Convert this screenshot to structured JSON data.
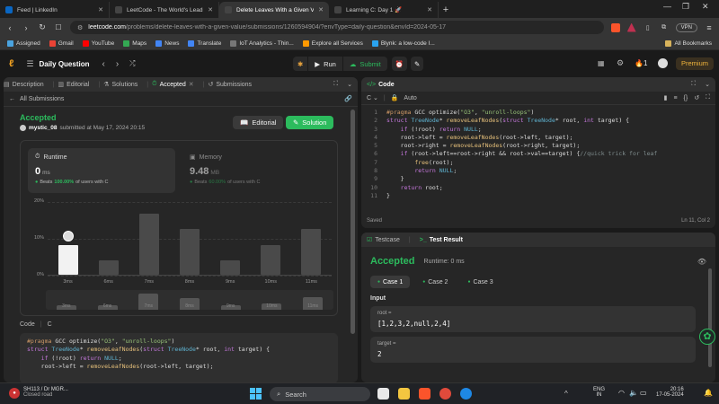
{
  "browser": {
    "tabs": [
      {
        "label": "Feed | LinkedIn",
        "color": "#0a66c2"
      },
      {
        "label": "LeetCode - The World's Leading Onl",
        "color": "#444"
      },
      {
        "label": "Delete Leaves With a Given Valu",
        "color": "#444",
        "active": true
      },
      {
        "label": "Learning C: Day 1 🚀",
        "color": "#444"
      }
    ],
    "new_tab": "+",
    "url_domain": "leetcode.com",
    "url_path": "/problems/delete-leaves-with-a-given-value/submissions/1260594904/?envType=daily-question&envId=2024-05-17",
    "vpn": "VPN",
    "bookmarks": [
      "Assigned",
      "Gmail",
      "YouTube",
      "Maps",
      "News",
      "Translate",
      "IoT Analytics - Thin...",
      "Explore all Services",
      "Blynk: a low-code I..."
    ],
    "all_bookmarks": "All Bookmarks"
  },
  "lc": {
    "daily": "Daily Question",
    "run": "Run",
    "submit": "Submit",
    "streak": "1",
    "premium": "Premium"
  },
  "left": {
    "tabs": [
      "Description",
      "Editorial",
      "Solutions",
      "Accepted",
      "Submissions"
    ],
    "back": "All Submissions",
    "status": "Accepted",
    "user": "mystic_08",
    "submitted": "submitted at May 17, 2024 20:15",
    "editorial_btn": "Editorial",
    "solution_btn": "Solution",
    "runtime_label": "Runtime",
    "runtime_value": "0",
    "runtime_unit": "ms",
    "runtime_beats_prefix": "Beats",
    "runtime_beats": "100.00%",
    "runtime_beats_suffix": "of users with C",
    "memory_label": "Memory",
    "memory_value": "9.48",
    "memory_unit": "MB",
    "memory_beats_prefix": "Beats",
    "memory_beats": "60.00%",
    "memory_beats_suffix": "of users with C",
    "code_label": "Code",
    "code_lang": "C",
    "code_lines": [
      "#pragma GCC optimize(\"O3\", \"unroll-loops\")",
      "struct TreeNode* removeLeafNodes(struct TreeNode* root, int target) {",
      "    if (!root) return NULL;",
      "    root->left = removeLeafNodes(root->left, target);"
    ]
  },
  "chart_data": {
    "type": "bar",
    "categories": [
      "3ms",
      "6ms",
      "7ms",
      "8ms",
      "9ms",
      "10ms",
      "11ms"
    ],
    "values": [
      8,
      4,
      16.5,
      12.5,
      4,
      8,
      12.5
    ],
    "highlight_index": 0,
    "y_ticks": [
      "20%",
      "10%",
      "0%"
    ],
    "ylim": [
      0,
      20
    ],
    "mini_values": [
      3,
      3,
      10,
      7,
      3,
      4,
      8
    ]
  },
  "editor": {
    "title": "Code",
    "lang": "C",
    "mode": "Auto",
    "status": "Saved",
    "position": "Ln 11, Col 2",
    "lines": [
      "#pragma GCC optimize(\"O3\", \"unroll-loops\")",
      "struct TreeNode* removeLeafNodes(struct TreeNode* root, int target) {",
      "    if (!root) return NULL;",
      "    root->left = removeLeafNodes(root->left, target);",
      "    root->right = removeLeafNodes(root->right, target);",
      "    if (root->left==root->right && root->val==target) {//quick trick for leaf",
      "        free(root);",
      "        return NULL;",
      "    }",
      "    return root;",
      "}"
    ]
  },
  "result": {
    "tab_testcase": "Testcase",
    "tab_result": "Test Result",
    "status": "Accepted",
    "runtime": "Runtime: 0 ms",
    "cases": [
      "Case 1",
      "Case 2",
      "Case 3"
    ],
    "input_label": "Input",
    "root_label": "root =",
    "root_value": "[1,2,3,2,null,2,4]",
    "target_label": "target =",
    "target_value": "2"
  },
  "taskbar": {
    "weather_temp": "SH113 / Dr MGR...",
    "weather_desc": "Closed road",
    "search": "Search",
    "lang1": "ENG",
    "lang2": "IN",
    "time": "20:16",
    "date": "17-05-2024"
  }
}
